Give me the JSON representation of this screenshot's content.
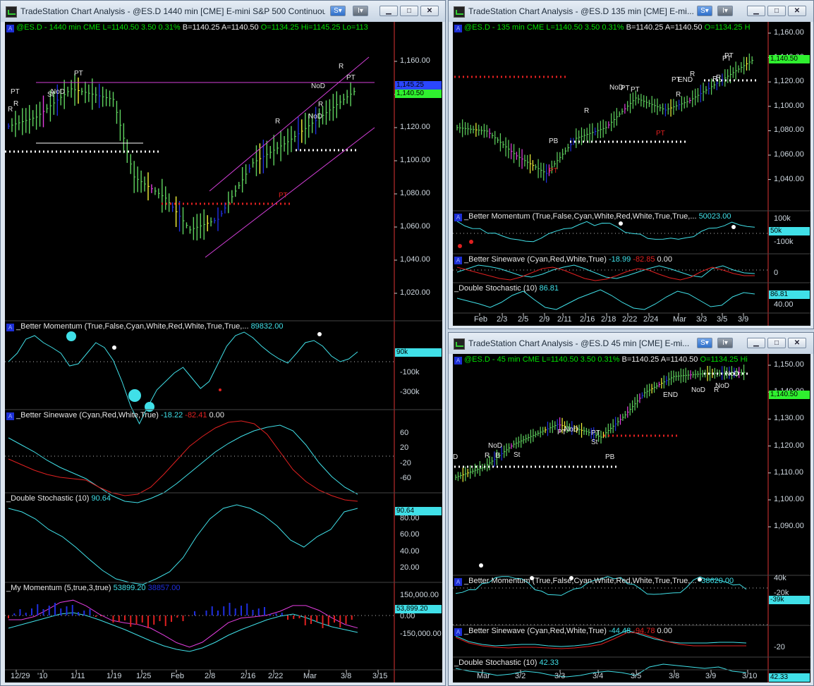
{
  "windows": {
    "daily": {
      "title": "TradeStation Chart Analysis - @ES.D 1440 min [CME] E-mini S&P 500 Continuou...",
      "quote": {
        "symbol": "@ES.D - 1440 min",
        "exchange": "CME",
        "last": "L=1140.50",
        "chg": "3.50",
        "pct": "0.31%",
        "bid": "B=1140.25",
        "ask": "A=1140.50",
        "open": "O=1134.25",
        "high": "Hi=1145.25",
        "low": "Lo=113"
      },
      "price_labels": [
        "1,160.00",
        "1,140.00",
        "1,120.00",
        "1,100.00",
        "1,080.00",
        "1,060.00",
        "1,040.00",
        "1,020.00"
      ],
      "price_tags": {
        "blue": "1,145.25",
        "green": "1,140.50"
      },
      "annotations": [
        "PT",
        "R",
        "St",
        "NoD",
        "PT",
        "R",
        "NoD",
        "R",
        "R",
        "NoD",
        "R",
        "PT",
        "PT"
      ],
      "panels": {
        "momentum": {
          "label": "_Better Momentum (True,False,Cyan,White,Red,White,True,True,...",
          "value": "89832.00",
          "scale": [
            "-100k",
            "-300k"
          ],
          "tag": "90k"
        },
        "sinewave": {
          "label": "_Better Sinewave (Cyan,Red,White,True)",
          "v1": "-18.22",
          "v2": "-82.41",
          "v3": "0.00",
          "scale": [
            "60",
            "20",
            "-20",
            "-60"
          ]
        },
        "stochastic": {
          "label": "_Double Stochastic (10)",
          "value": "90.64",
          "scale": [
            "80.00",
            "60.00",
            "40.00",
            "20.00"
          ],
          "tag": "90.64"
        },
        "mymomentum": {
          "label": "_My Momentum (5,true,3,true)",
          "v1": "53899.20",
          "v2": "38857.00",
          "scale": [
            "150,000.00",
            "-150,000.00"
          ],
          "tag": "53,899.20",
          "scale_partial": "0.00"
        }
      },
      "dates": [
        "12/29",
        "'10",
        "1/11",
        "1/19",
        "1/25",
        "Feb",
        "2/8",
        "2/16",
        "2/22",
        "Mar",
        "3/8",
        "3/15"
      ]
    },
    "min135": {
      "title": "TradeStation Chart Analysis - @ES.D 135 min [CME] E-mi...",
      "quote": {
        "symbol": "@ES.D - 135 min",
        "exchange": "CME",
        "last": "L=1140.50",
        "chg": "3.50",
        "pct": "0.31%",
        "bid": "B=1140.25",
        "ask": "A=1140.50",
        "open": "O=1134.25",
        "high": "H"
      },
      "price_labels": [
        "1,160.00",
        "1,140.00",
        "1,120.00",
        "1,100.00",
        "1,080.00",
        "1,060.00",
        "1,040.00"
      ],
      "price_tag": "1,140.50",
      "annotations": [
        "PT",
        "R",
        "NoD",
        "PT",
        "PT",
        "R",
        "PB",
        "PT",
        "PT",
        "R",
        "END",
        "R",
        "PT",
        "R",
        "PT"
      ],
      "panels": {
        "momentum": {
          "label": "_Better Momentum (True,False,Cyan,White,Red,White,True,True,...",
          "value": "50023.00",
          "scale": [
            "100k",
            "-100k"
          ],
          "tag": "50k"
        },
        "sinewave": {
          "label": "_Better Sinewave (Cyan,Red,White,True)",
          "v1": "-18.99",
          "v2": "-82.85",
          "v3": "0.00",
          "scale": [
            "0"
          ]
        },
        "stochastic": {
          "label": "_Double Stochastic (10)",
          "value": "86.81",
          "scale": [
            "40.00"
          ],
          "tag": "86.81"
        }
      },
      "dates": [
        "Feb",
        "2/3",
        "2/5",
        "2/9",
        "2/11",
        "2/16",
        "2/18",
        "2/22",
        "2/24",
        "Mar",
        "3/3",
        "3/5",
        "3/9"
      ]
    },
    "min45": {
      "title": "TradeStation Chart Analysis - @ES.D 45 min [CME] E-mi...",
      "quote": {
        "symbol": "@ES.D - 45 min",
        "exchange": "CME",
        "last": "L=1140.50",
        "chg": "3.50",
        "pct": "0.31%",
        "bid": "B=1140.25",
        "ask": "A=1140.50",
        "open": "O=1134.25",
        "high": "Hi"
      },
      "price_labels": [
        "1,150.00",
        "1,140.00",
        "1,130.00",
        "1,120.00",
        "1,110.00",
        "1,100.00",
        "1,090.00"
      ],
      "price_tag": "1,140.50",
      "annotations": [
        "D",
        "NoD",
        "R",
        "B",
        "St",
        "PT",
        "NoD",
        "St",
        "PT",
        "PB",
        "END",
        "NoD",
        "NoD",
        "NoD",
        "R"
      ],
      "panels": {
        "momentum": {
          "label": "_Better Momentum (True,False,Cyan,White,Red,White,True,True,...",
          "value": "-38620.00",
          "scale": [
            "40k",
            "-20k"
          ],
          "tag": "-39k"
        },
        "sinewave": {
          "label": "_Better Sinewave (Cyan,Red,White,True)",
          "v1": "-44.48",
          "v2": "-94.78",
          "v3": "0.00",
          "scale": [
            "-20"
          ]
        },
        "stochastic": {
          "label": "_Double Stochastic (10)",
          "value": "42.33",
          "tag": "42.33"
        }
      },
      "dates": [
        "Mar",
        "3/2",
        "3/3",
        "3/4",
        "3/5",
        "3/8",
        "3/9",
        "3/10"
      ]
    }
  },
  "colors": {
    "up": "#5fd35f",
    "down": "#1f2fe0",
    "yellow": "#f5f53a",
    "magenta": "#e43ee0",
    "cyan": "#40e0e8",
    "red": "#e02020",
    "trend": "#d33fd8",
    "green_text": "#00e000"
  }
}
